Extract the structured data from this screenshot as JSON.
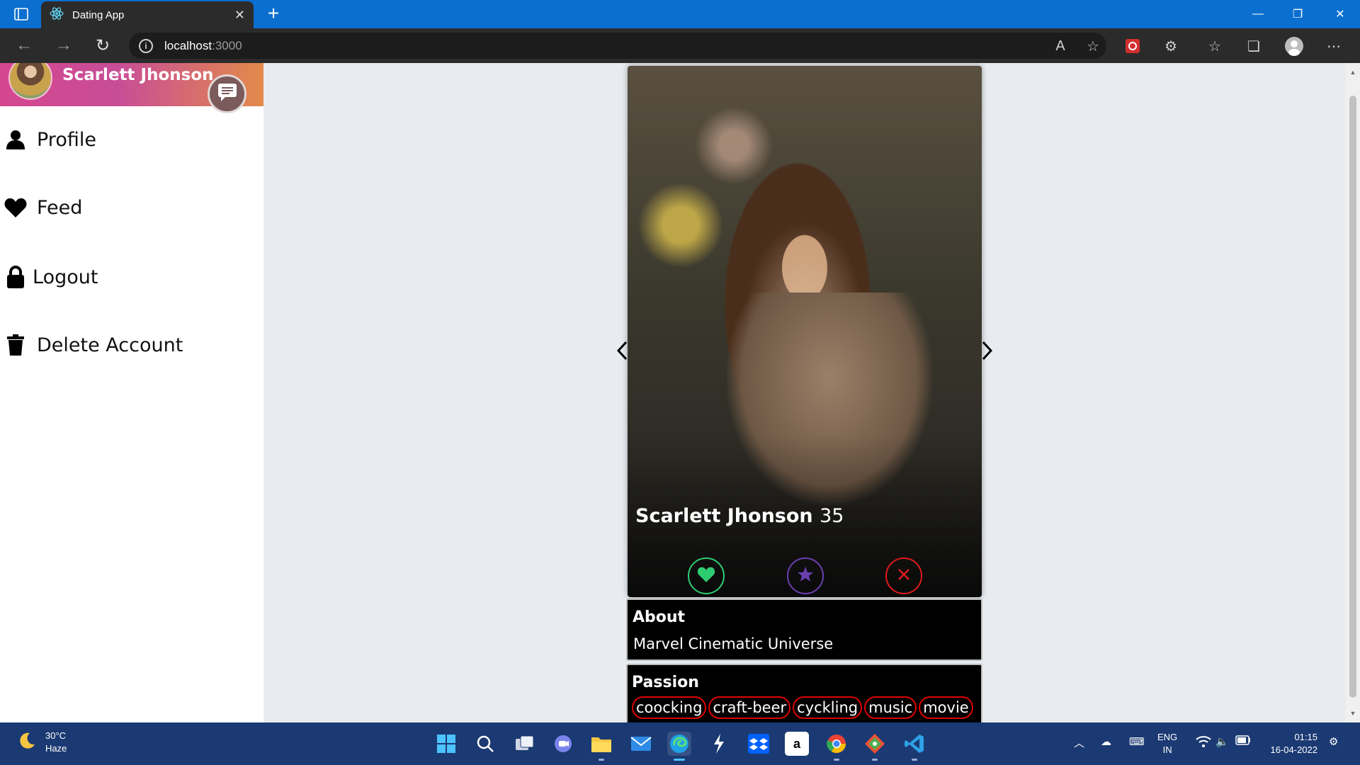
{
  "browser": {
    "tab_title": "Dating App",
    "url_host": "localhost",
    "url_port": ":3000"
  },
  "sidebar": {
    "user_name": "Scarlett Jhonson",
    "items": [
      {
        "label": "Profile",
        "icon": "person-icon"
      },
      {
        "label": "Feed",
        "icon": "heart-icon"
      },
      {
        "label": "Logout",
        "icon": "lock-icon"
      },
      {
        "label": "Delete Account",
        "icon": "trash-icon"
      }
    ]
  },
  "card": {
    "name": "Scarlett Jhonson",
    "age": "35",
    "actions": [
      {
        "name": "like",
        "icon": "heart-icon",
        "color": "#2ecc71"
      },
      {
        "name": "superlike",
        "icon": "star-icon",
        "color": "#6a3fb0"
      },
      {
        "name": "reject",
        "icon": "close-icon",
        "color": "#e01b1b"
      }
    ]
  },
  "about": {
    "title": "About",
    "text": "Marvel Cinematic Universe"
  },
  "passion": {
    "title": "Passion",
    "tags": [
      "coocking",
      "craft-beer",
      "cyckling",
      "music",
      "movie"
    ]
  },
  "taskbar": {
    "weather_temp": "30°C",
    "weather_desc": "Haze",
    "lang_1": "ENG",
    "lang_2": "IN",
    "time": "01:15",
    "date": "16-04-2022"
  },
  "colors": {
    "titlebar": "#0b6fd0",
    "like": "#2ecc71",
    "superlike": "#6a3fb0",
    "reject": "#e01b1b",
    "tag_border": "#dd0000"
  }
}
